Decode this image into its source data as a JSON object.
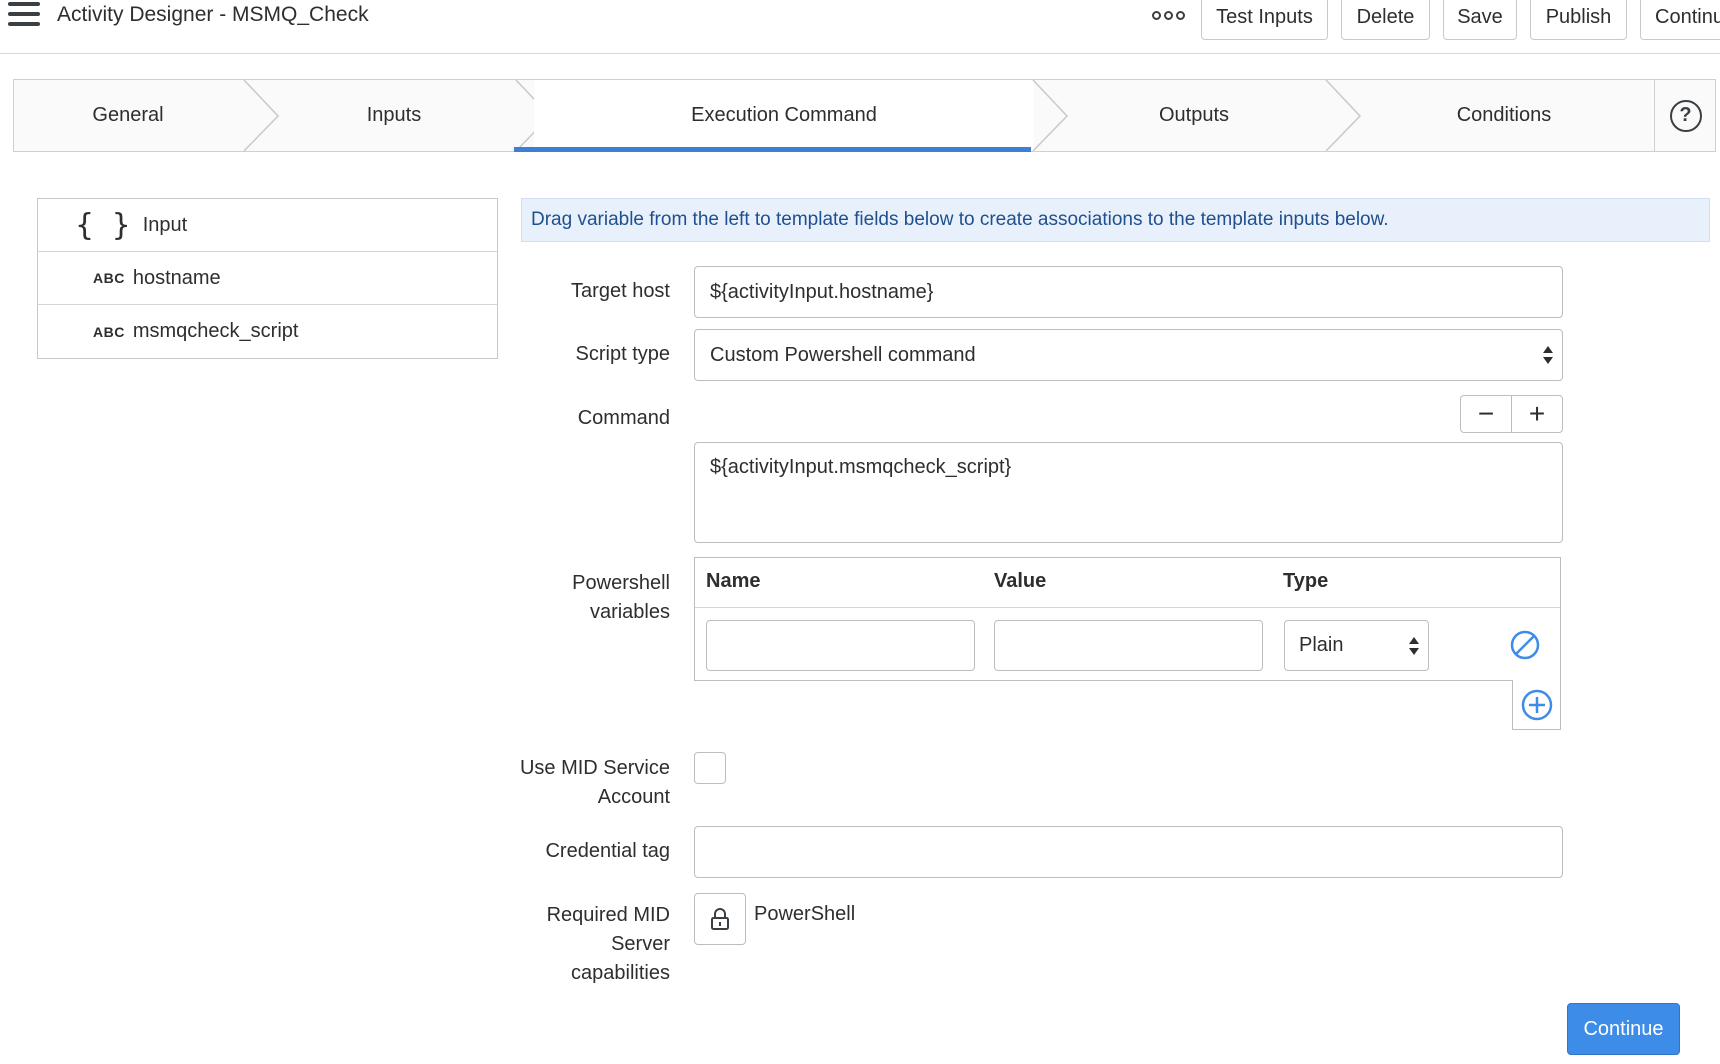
{
  "header": {
    "title": "Activity Designer - MSMQ_Check",
    "buttons": {
      "test_inputs": "Test Inputs",
      "delete": "Delete",
      "save": "Save",
      "publish": "Publish",
      "continue": "Continu"
    }
  },
  "tabs": [
    {
      "label": "General"
    },
    {
      "label": "Inputs"
    },
    {
      "label": "Execution Command",
      "active": true
    },
    {
      "label": "Outputs"
    },
    {
      "label": "Conditions"
    }
  ],
  "help_icon": "?",
  "variables": {
    "root_braces": "{ }",
    "root_label": "Input",
    "type_badge": "ABC",
    "items": [
      {
        "label": "hostname"
      },
      {
        "label": "msmqcheck_script"
      }
    ]
  },
  "banner": "Drag variable from the left to template fields below to create associations to the template inputs below.",
  "form": {
    "target_host": {
      "label": "Target host",
      "value": "${activityInput.hostname}"
    },
    "script_type": {
      "label": "Script type",
      "value": "Custom Powershell command"
    },
    "command": {
      "label": "Command",
      "value": "${activityInput.msmqcheck_script}",
      "minus": "−",
      "plus": "+"
    },
    "powershell_variables": {
      "label_line1": "Powershell",
      "label_line2": "variables",
      "columns": [
        "Name",
        "Value",
        "Type"
      ],
      "row": {
        "type": "Plain"
      }
    },
    "use_mid_service_account": {
      "label_line1": "Use MID Service",
      "label_line2": "Account"
    },
    "credential_tag": {
      "label": "Credential tag"
    },
    "required_mid": {
      "label_line1": "Required MID",
      "label_line2": "Server",
      "label_line3": "capabilities",
      "capability": "PowerShell"
    }
  },
  "footer": {
    "continue": "Continue"
  },
  "colors": {
    "accent": "#3d7fd6",
    "banner_bg": "#e8f1fb",
    "banner_text": "#1f4f8f",
    "primary_button": "#3d8ce8"
  }
}
